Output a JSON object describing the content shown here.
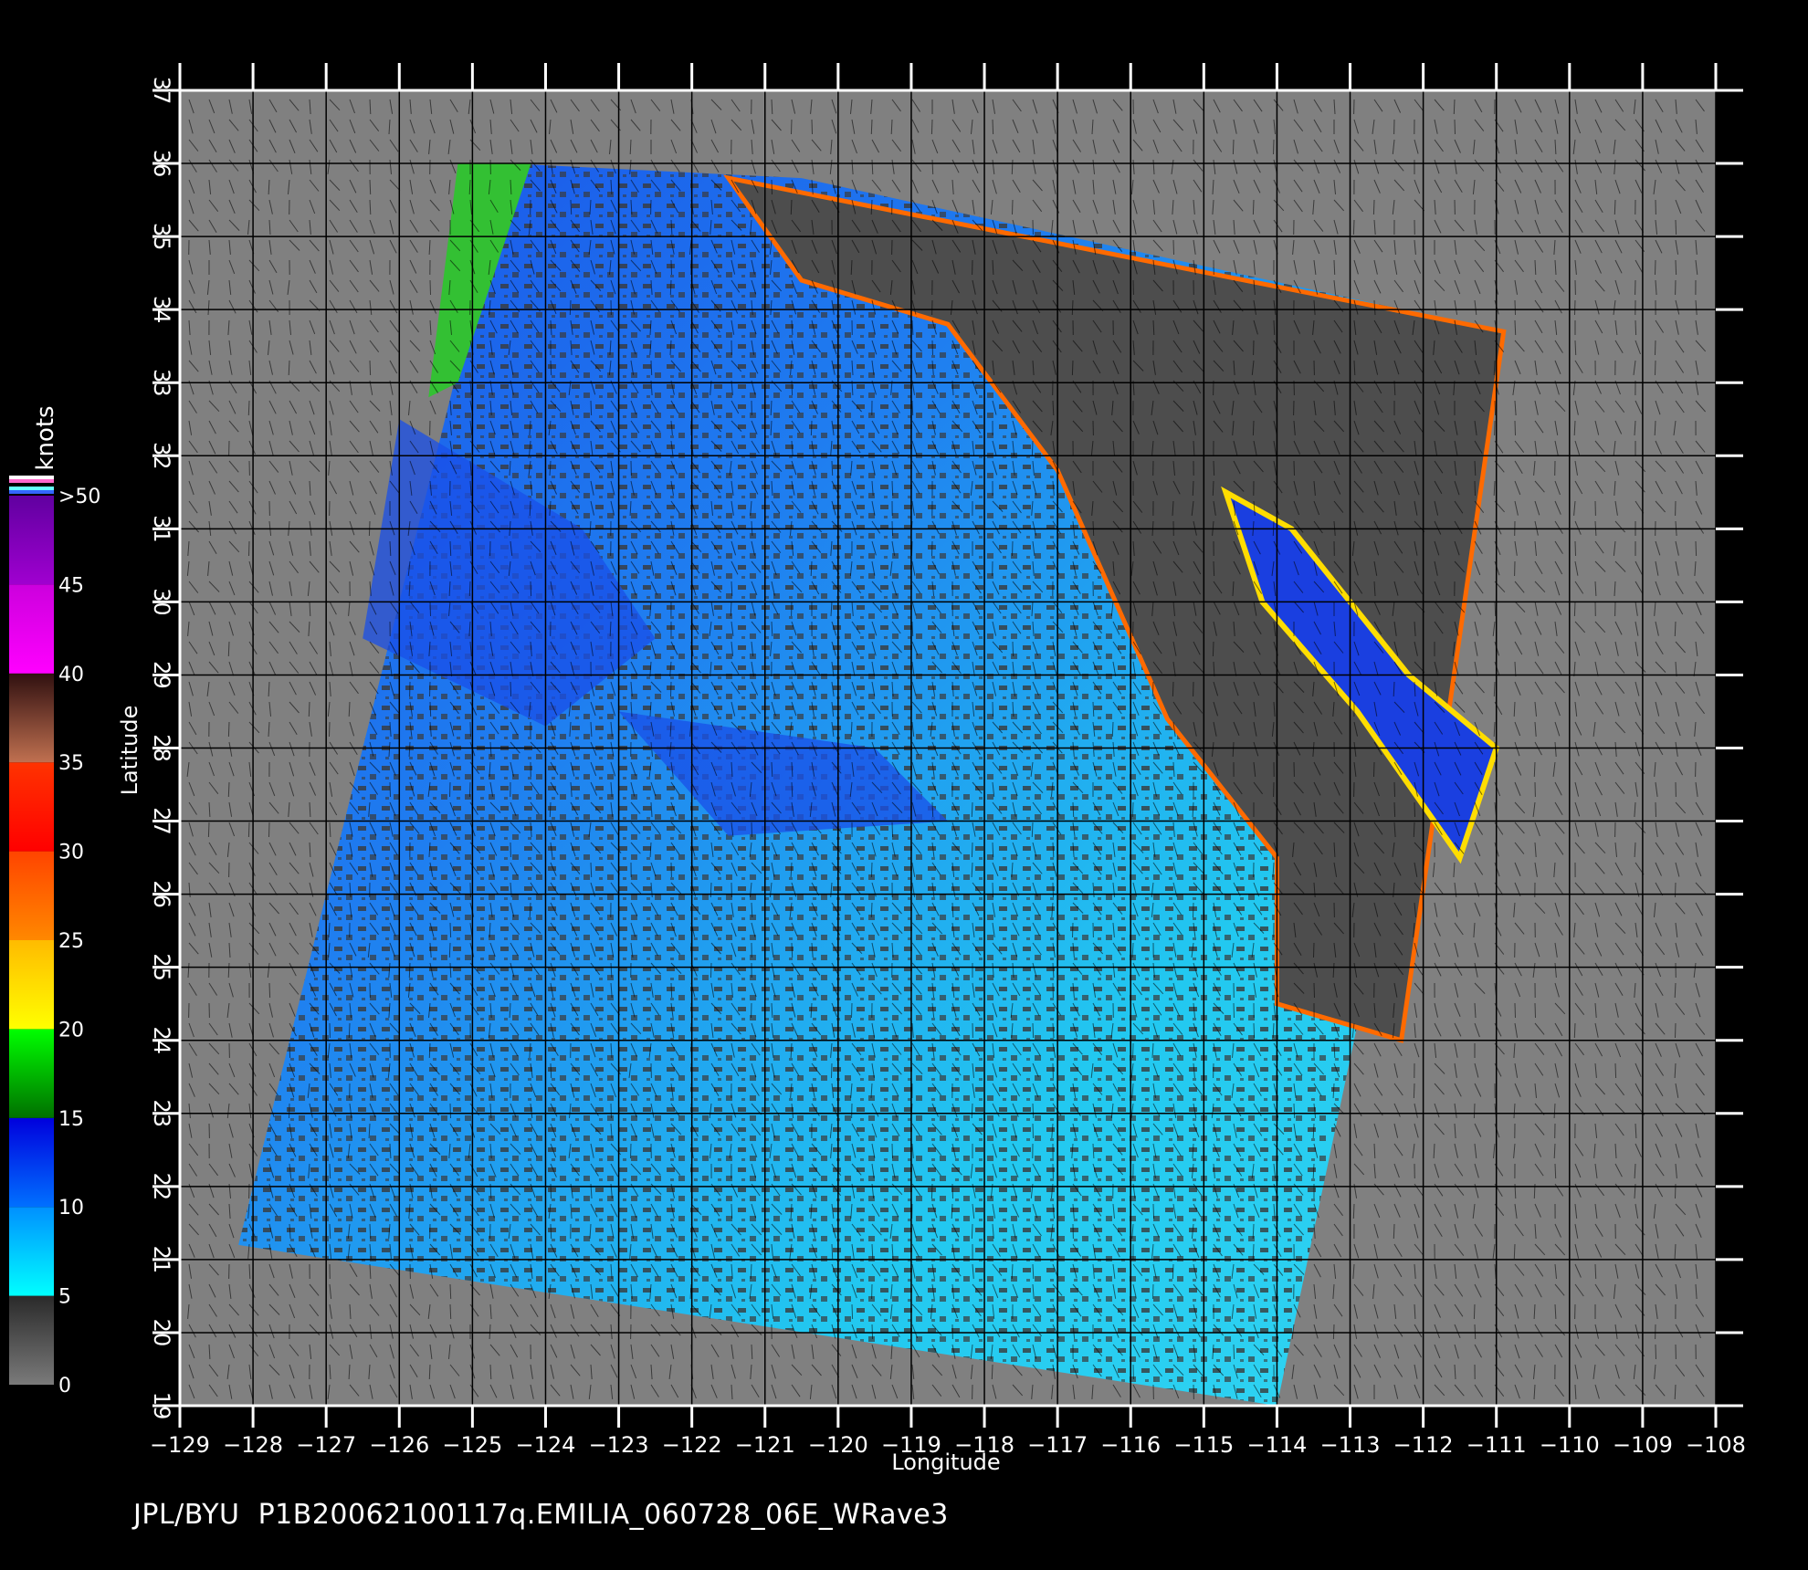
{
  "footer": {
    "source": "JPL/BYU",
    "filename": "P1B20062100117q.EMILIA_060728_06E_WRave3"
  },
  "axes": {
    "x_label": "Longitude",
    "y_label": "Latitude",
    "x_range": [
      -129,
      -108
    ],
    "y_range": [
      19,
      37
    ],
    "x_ticks": [
      "−129",
      "−128",
      "−127",
      "−126",
      "−125",
      "−124",
      "−123",
      "−122",
      "−121",
      "−120",
      "−119",
      "−118",
      "−117",
      "−116",
      "−115",
      "−114",
      "−113",
      "−112",
      "−111",
      "−110",
      "−109",
      "−108"
    ],
    "y_ticks": [
      "19",
      "20",
      "21",
      "22",
      "23",
      "24",
      "25",
      "26",
      "27",
      "28",
      "29",
      "30",
      "31",
      "32",
      "33",
      "34",
      "35",
      "36",
      "37"
    ]
  },
  "colorbar": {
    "title": "knots",
    "labels": [
      ">50",
      "45",
      "40",
      "35",
      "30",
      "25",
      "20",
      "15",
      "10",
      "5",
      "0"
    ],
    "levels": [
      50,
      45,
      40,
      35,
      30,
      25,
      20,
      15,
      10,
      5,
      0
    ],
    "segments": [
      {
        "from": 0,
        "to": 5,
        "color_a": "#7a7a7a",
        "color_b": "#2a2a2a"
      },
      {
        "from": 5,
        "to": 10,
        "color_a": "#00ffff",
        "color_b": "#0090ff"
      },
      {
        "from": 10,
        "to": 15,
        "color_a": "#0070ff",
        "color_b": "#0000dd"
      },
      {
        "from": 15,
        "to": 20,
        "color_a": "#007000",
        "color_b": "#00ff00"
      },
      {
        "from": 20,
        "to": 25,
        "color_a": "#ffff00",
        "color_b": "#ffbb00"
      },
      {
        "from": 25,
        "to": 30,
        "color_a": "#ff8800",
        "color_b": "#ff4400"
      },
      {
        "from": 30,
        "to": 35,
        "color_a": "#ff0000",
        "color_b": "#ff3300"
      },
      {
        "from": 35,
        "to": 40,
        "color_a": "#c07050",
        "color_b": "#301010"
      },
      {
        "from": 40,
        "to": 45,
        "color_a": "#ff00ff",
        "color_b": "#cc00dd"
      },
      {
        "from": 45,
        "to": 50,
        "color_a": "#a000d0",
        "color_b": "#6000a0"
      }
    ],
    "top_stripes": [
      "#ffffff",
      "#ff66cc",
      "#000000",
      "#66ffff",
      "#3366ff"
    ]
  },
  "colors": {
    "background": "#000000",
    "map_gray": "#808080",
    "swath_dark": "#4d4d4d",
    "ocean_light": "#22c8f0",
    "ocean_deep": "#1a4fe8",
    "grid": "#000000"
  },
  "map": {
    "swath_lonlat": [
      [
        -124.5,
        36
      ],
      [
        -120.5,
        35.8
      ],
      [
        -110.9,
        33.7
      ],
      [
        -114.0,
        19.0
      ],
      [
        -128.2,
        21.2
      ]
    ],
    "land_gray_lonlat": [
      [
        -121.5,
        35.8
      ],
      [
        -110.9,
        33.7
      ],
      [
        -112.3,
        24.0
      ],
      [
        -114.0,
        24.5
      ],
      [
        -114.0,
        26.5
      ],
      [
        -115.5,
        28.4
      ],
      [
        -117.0,
        31.8
      ],
      [
        -118.5,
        33.8
      ],
      [
        -120.5,
        34.4
      ],
      [
        -121.5,
        35.8
      ]
    ],
    "baja_gulf_lonlat": [
      [
        -114.7,
        31.5
      ],
      [
        -113.8,
        31.0
      ],
      [
        -112.2,
        29.0
      ],
      [
        -111.0,
        28.0
      ],
      [
        -111.5,
        26.5
      ],
      [
        -112.9,
        28.5
      ],
      [
        -114.2,
        30.0
      ]
    ],
    "deep_wind_zones_lonlat": [
      [
        [
          -126.0,
          32.5
        ],
        [
          -123.5,
          31.0
        ],
        [
          -122.5,
          29.5
        ],
        [
          -124.0,
          28.3
        ],
        [
          -126.5,
          29.5
        ]
      ],
      [
        [
          -123.0,
          28.5
        ],
        [
          -119.5,
          28.0
        ],
        [
          -118.5,
          27.0
        ],
        [
          -121.5,
          26.8
        ]
      ]
    ],
    "high_wind_strip_lonlat": [
      [
        -125.2,
        36.0
      ],
      [
        -124.2,
        36.0
      ],
      [
        -125.2,
        33.0
      ],
      [
        -125.6,
        32.8
      ]
    ]
  }
}
